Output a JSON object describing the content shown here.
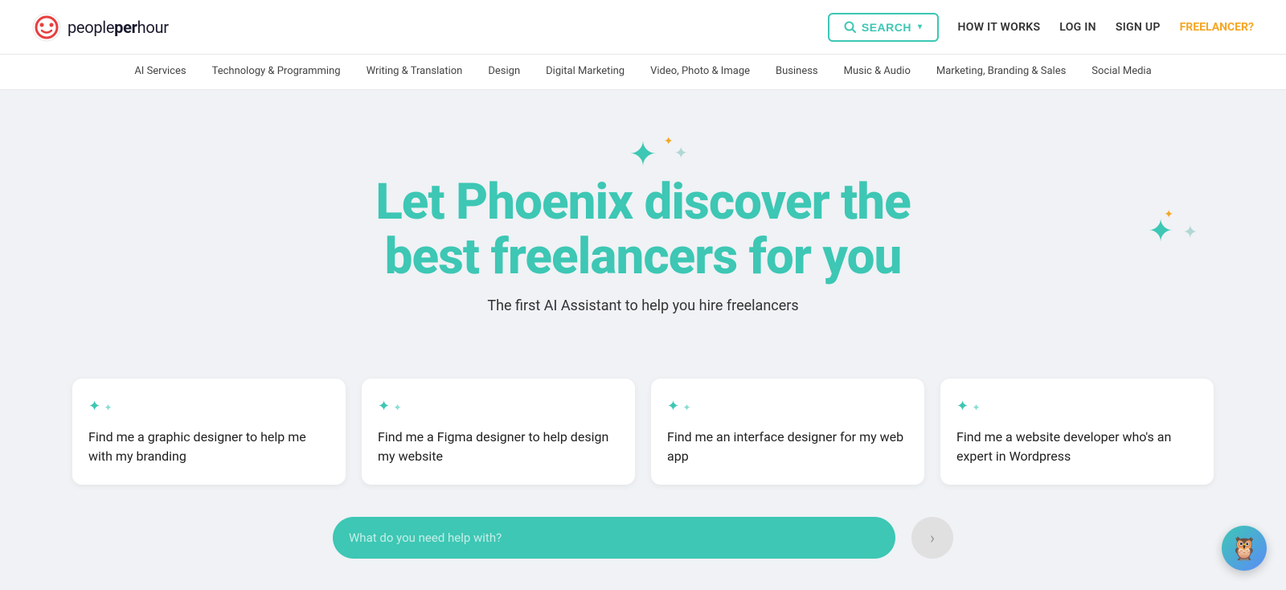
{
  "header": {
    "logo_text_light": "people",
    "logo_text_bold": "per",
    "logo_text_end": "hour",
    "search_label": "SEARCH",
    "how_it_works": "HOW IT WORKS",
    "log_in": "LOG IN",
    "sign_up": "SIGN UP",
    "freelancer": "FREELANCER?"
  },
  "categories": [
    "AI Services",
    "Technology & Programming",
    "Writing & Translation",
    "Design",
    "Digital Marketing",
    "Video, Photo & Image",
    "Business",
    "Music & Audio",
    "Marketing, Branding & Sales",
    "Social Media"
  ],
  "hero": {
    "title": "Let Phoenix discover the best freelancers for you",
    "subtitle": "The first AI Assistant to help you hire freelancers"
  },
  "cards": [
    {
      "text": "Find me a graphic designer to help me with my branding"
    },
    {
      "text": "Find me a Figma designer to help design my website"
    },
    {
      "text": "Find me an interface designer for my web app"
    },
    {
      "text": "Find me a website developer who's an expert in Wordpress"
    }
  ],
  "input": {
    "placeholder": "What do you need help with?"
  },
  "chat": {
    "icon": "🦉"
  }
}
